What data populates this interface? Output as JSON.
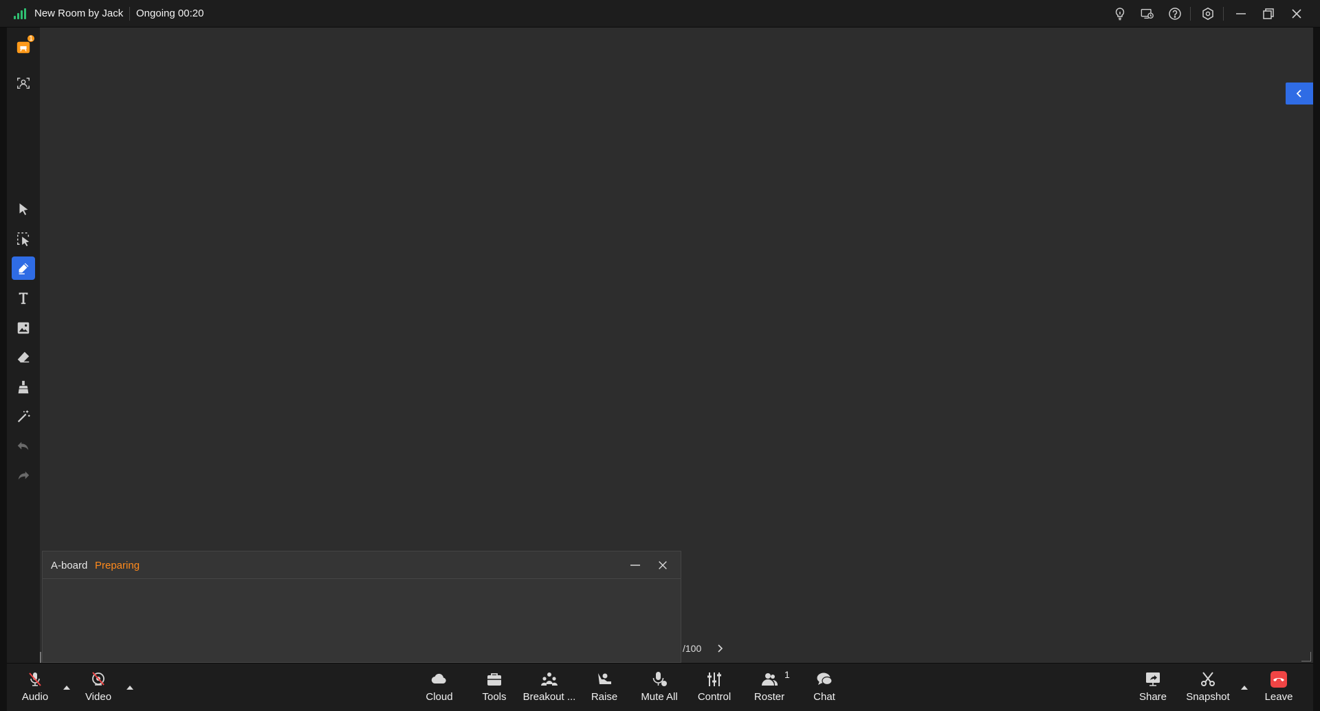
{
  "titlebar": {
    "room_title": "New Room by Jack",
    "status": "Ongoing 00:20",
    "icons": [
      "bulb-icon",
      "screen-record-icon",
      "help-icon",
      "settings-icon",
      "minimize-icon",
      "restore-icon",
      "close-icon"
    ]
  },
  "left_toolbar": {
    "top_items": [
      {
        "name": "courseware-icon",
        "badge": "1"
      },
      {
        "name": "participant-view-icon"
      }
    ],
    "tools": [
      "select-tool-icon",
      "area-select-tool-icon",
      "pen-tool-icon",
      "text-tool-icon",
      "image-tool-icon",
      "eraser-tool-icon",
      "clear-tool-icon",
      "laser-pointer-icon",
      "undo-icon",
      "redo-icon"
    ],
    "active_tool": "pen-tool-icon"
  },
  "aboard": {
    "title": "A-board",
    "status": "Preparing"
  },
  "pagination": {
    "text": "/100"
  },
  "bottombar": {
    "audio": "Audio",
    "video": "Video",
    "cloud": "Cloud",
    "tools": "Tools",
    "breakout": "Breakout ...",
    "raise": "Raise",
    "mute_all": "Mute All",
    "control": "Control",
    "roster": "Roster",
    "roster_count": "1",
    "chat": "Chat",
    "share": "Share",
    "snapshot": "Snapshot",
    "leave": "Leave"
  },
  "colors": {
    "accent": "#2f6ce5",
    "status_orange": "#ff8a1c",
    "leave_red": "#f04545",
    "signal_green": "#2fbf71"
  }
}
